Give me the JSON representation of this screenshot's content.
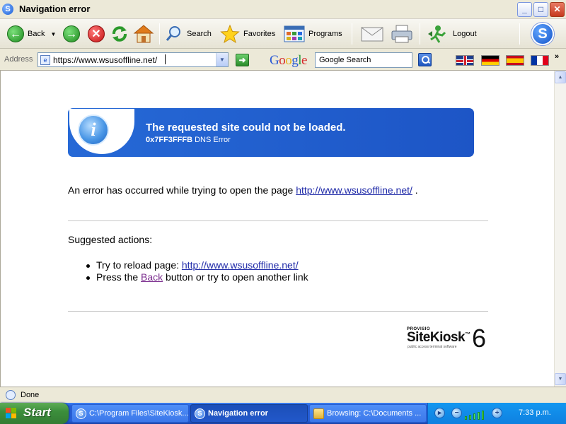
{
  "window": {
    "title": "Navigation error",
    "app_icon": "S",
    "controls": {
      "minimize": "_",
      "maximize": "□",
      "close": "✕"
    }
  },
  "toolbar": {
    "back": "Back",
    "search": "Search",
    "favorites": "Favorites",
    "programs": "Programs",
    "logout": "Logout",
    "kiosk_logo": "S"
  },
  "address_bar": {
    "label": "Address",
    "url": "https://www.wsusoffline.net/",
    "google_logo": "Google",
    "google_search_value": "Google Search",
    "more": "»",
    "flags": [
      "english-flag",
      "german-flag",
      "spanish-flag",
      "french-flag"
    ]
  },
  "page": {
    "error_title": "The requested site could not be loaded.",
    "error_code": "0x7FF3FFFB",
    "error_type": "DNS Error",
    "error_text_prefix": "An error has occurred while trying to open the page",
    "error_link": "http://www.wsusoffline.net/",
    "error_text_suffix": ".",
    "suggested_heading": "Suggested actions:",
    "action_reload_prefix": "Try to reload page:",
    "action_reload_link": "http://www.wsusoffline.net/",
    "action_back_prefix": "Press the",
    "action_back_link": "Back",
    "action_back_suffix": "button or try to open another link",
    "logo": {
      "provisio": "PROVISIO",
      "name": "SiteKiosk",
      "tm": "™",
      "version": "6",
      "tagline": "public access terminal software"
    }
  },
  "statusbar": {
    "text": "Done"
  },
  "taskbar": {
    "start": "Start",
    "items": [
      {
        "label": "C:\\Program Files\\SiteKiosk...",
        "active": false
      },
      {
        "label": "Navigation error",
        "active": true
      },
      {
        "label": "Browsing: C:\\Documents ...",
        "active": false
      }
    ],
    "clock": "7:33 p.m."
  },
  "colors": {
    "banner": "#1d5fd0",
    "link": "#1f2aa8",
    "visited_link": "#7b2d8e",
    "taskbar": "#245edb",
    "start_button": "#3c8f3c"
  }
}
